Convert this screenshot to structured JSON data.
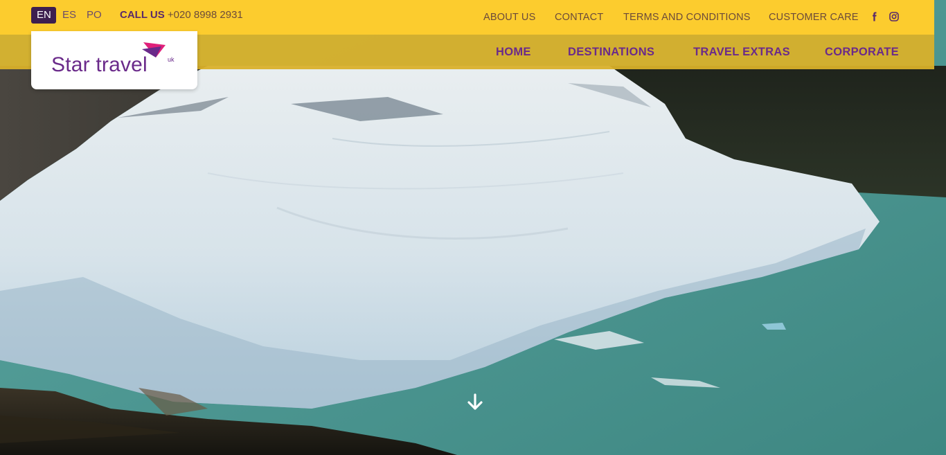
{
  "header": {
    "languages": [
      {
        "code": "EN",
        "active": true
      },
      {
        "code": "ES",
        "active": false
      },
      {
        "code": "PO",
        "active": false
      }
    ],
    "call_label": "CALL US",
    "call_number": "+020 8998 2931",
    "top_links": [
      "ABOUT US",
      "CONTACT",
      "TERMS AND CONDITIONS",
      "CUSTOMER CARE"
    ],
    "social_icons": [
      "facebook-icon",
      "instagram-icon"
    ]
  },
  "logo": {
    "name": "Star travel",
    "suffix": "uk"
  },
  "main_nav": [
    "HOME",
    "DESTINATIONS",
    "TRAVEL EXTRAS",
    "CORPORATE"
  ],
  "hero": {
    "scroll_icon": "arrow-down-icon"
  },
  "colors": {
    "brand_yellow": "#fccc2e",
    "brand_purple": "#6a2a8a",
    "active_lang_bg": "#3d1f4f",
    "logo_mark_pink": "#e0207a"
  }
}
